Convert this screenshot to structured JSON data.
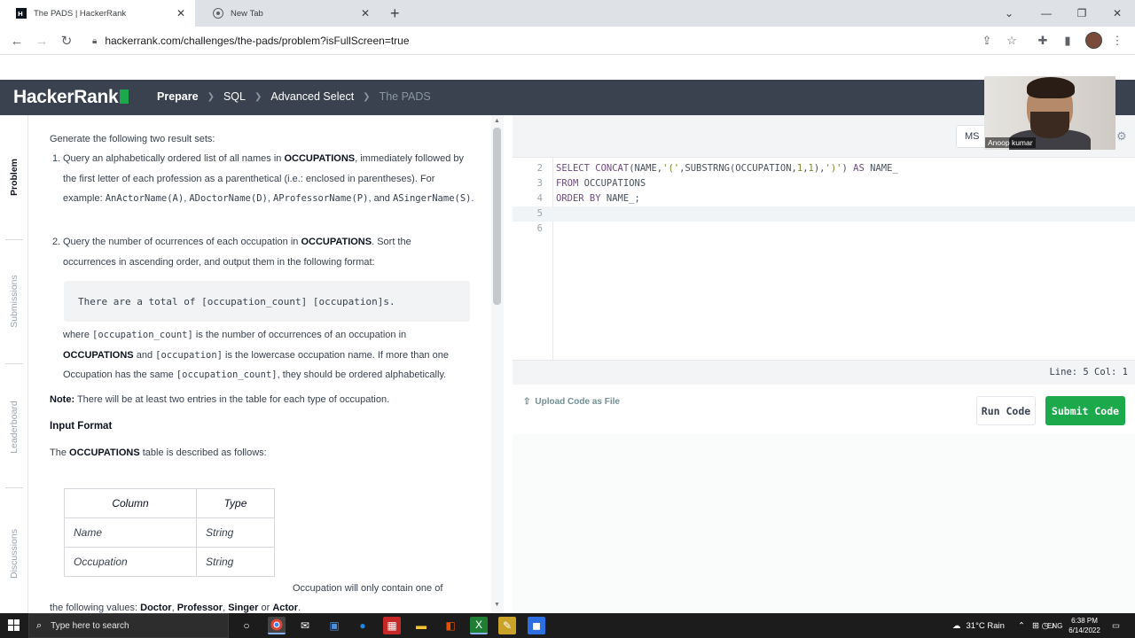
{
  "browser": {
    "tabs": [
      {
        "title": "The PADS | HackerRank",
        "active": true
      },
      {
        "title": "New Tab",
        "active": false
      }
    ],
    "url": "hackerrank.com/challenges/the-pads/problem?isFullScreen=true"
  },
  "header": {
    "logo": "HackerRank",
    "breadcrumbs": [
      "Prepare",
      "SQL",
      "Advanced Select",
      "The PADS"
    ]
  },
  "side_tabs": [
    "Problem",
    "Submissions",
    "Leaderboard",
    "Discussions"
  ],
  "problem": {
    "intro": "Generate the following two result sets:",
    "item1_num": "1.",
    "item1_a": "Query an alphabetically ordered list of all names in ",
    "item1_b": "OCCUPATIONS",
    "item1_c": ", immediately followed by the first letter of each profession as a parenthetical (i.e.: enclosed in parentheses). For example: ",
    "ex1": "AnActorName(A)",
    "ex2": "ADoctorName(D)",
    "ex3": "AProfessorName(P)",
    "and": ", and ",
    "ex4": "ASingerName(S)",
    "item2_num": "2.",
    "item2_a": "Query the number of ocurrences of each occupation in ",
    "item2_b": "OCCUPATIONS",
    "item2_c": ". Sort the occurrences in ascending order, and output them in the following format:",
    "format": "There are a total of [occupation_count] [occupation]s.",
    "where": "where ",
    "occ_count": "[occupation_count]",
    "where_b": " is the number of occurrences of an occupation in ",
    "occs": "OCCUPATIONS",
    "and2": " and ",
    "occ": "[occupation]",
    "where_c": " is the lowercase occupation name. If more than one Occupation has the same ",
    "occ_count2": "[occupation_count]",
    "where_d": ", they should be ordered alphabetically.",
    "note_label": "Note:",
    "note": " There will be at least two entries in the table for each type of occupation.",
    "input_format": "Input Format",
    "table_desc_a": "The ",
    "table_desc_b": "OCCUPATIONS",
    "table_desc_c": " table is described as follows:",
    "table_headers": [
      "Column",
      "Type"
    ],
    "table_rows": [
      [
        "Name",
        "String"
      ],
      [
        "Occupation",
        "String"
      ]
    ],
    "values_a": "Occupation will only contain one of",
    "values_b": "the following values: ",
    "v1": "Doctor",
    "v2": "Professor",
    "v3": "Singer",
    "or": " or ",
    "v4": "Actor",
    "comma": ", "
  },
  "editor": {
    "language": "MS SQL",
    "lines": [
      {
        "n": "2",
        "text": "SELECT CONCAT(NAME,'(',SUBSTRNG(OCCUPATION,1,1),')') AS NAME_"
      },
      {
        "n": "3",
        "text": "FROM OCCUPATIONS"
      },
      {
        "n": "4",
        "text": "ORDER BY NAME_;"
      },
      {
        "n": "5",
        "text": ""
      },
      {
        "n": "6",
        "text": ""
      }
    ],
    "status": "Line: 5 Col: 1",
    "upload": "Upload Code as File",
    "run": "Run Code",
    "submit": "Submit Code"
  },
  "webcam": {
    "name": "Anoop kumar"
  },
  "taskbar": {
    "search_placeholder": "Type here to search",
    "weather": "31°C  Rain",
    "lang": "ENG",
    "time": "6:38 PM",
    "date": "6/14/2022"
  },
  "colors": {
    "accent": "#1ba94c",
    "header_bg": "#39424e",
    "text": "#39424e"
  }
}
